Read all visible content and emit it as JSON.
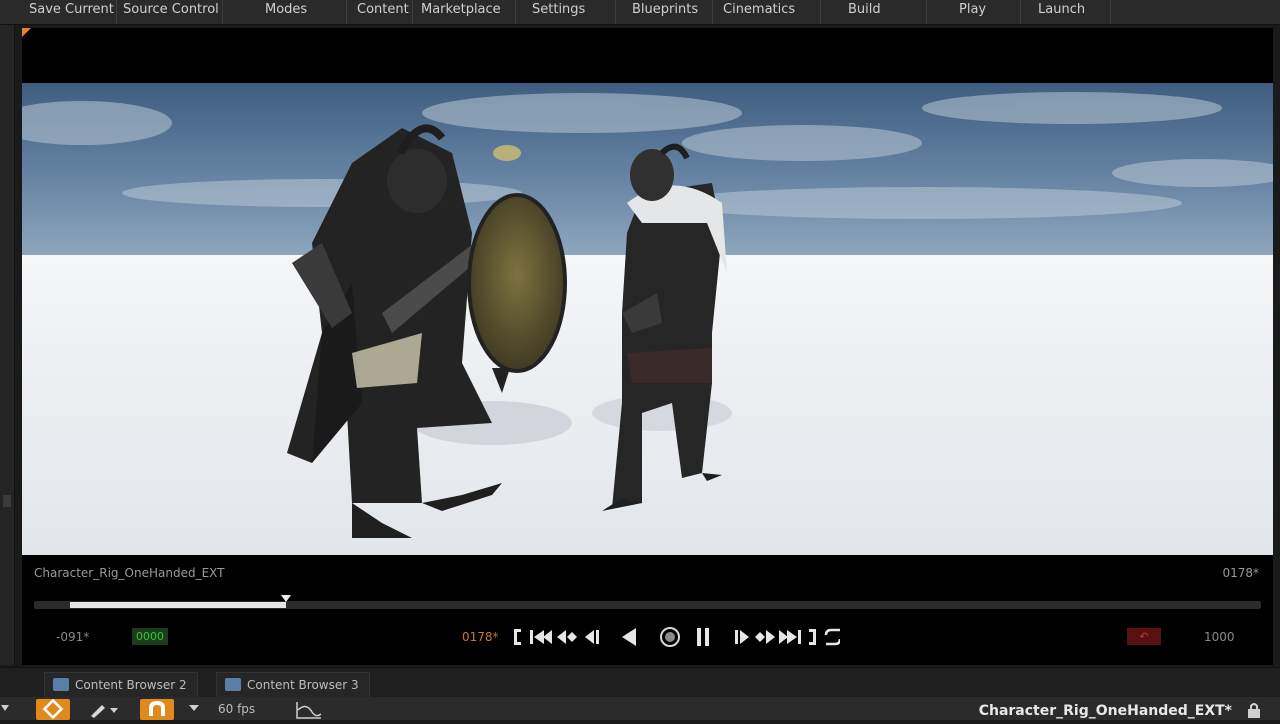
{
  "toolbar": {
    "items": [
      "Save Current",
      "Source Control",
      "Modes",
      "Content",
      "Marketplace",
      "Settings",
      "Blueprints",
      "Cinematics",
      "Build",
      "Play",
      "Launch"
    ]
  },
  "timeline": {
    "animation_name": "Character_Rig_OneHanded_EXT",
    "frame_readout": "0178*",
    "start_frame": "-091*",
    "current_frame": "0178*",
    "end_frame": "1000",
    "green_field": "0000",
    "red_field": "↶",
    "scrub_position": 0.205,
    "transport_icons": [
      "bracket-start-icon",
      "skip-start-icon",
      "step-back-key-icon",
      "step-back-frame-icon",
      "play-reverse-icon",
      "record-icon",
      "pause-icon",
      "step-forward-frame-icon",
      "step-forward-key-icon",
      "skip-end-icon",
      "bracket-end-icon",
      "loop-icon"
    ]
  },
  "tabs": [
    {
      "label": "Content Browser 2"
    },
    {
      "label": "Content Browser 3"
    }
  ],
  "bottombar": {
    "fps": "60 fps",
    "asset": "Character_Rig_OneHanded_EXT*"
  },
  "colors": {
    "accent": "#e08a1e",
    "sky": "#4f6f92",
    "ground": "#e9ebee"
  }
}
